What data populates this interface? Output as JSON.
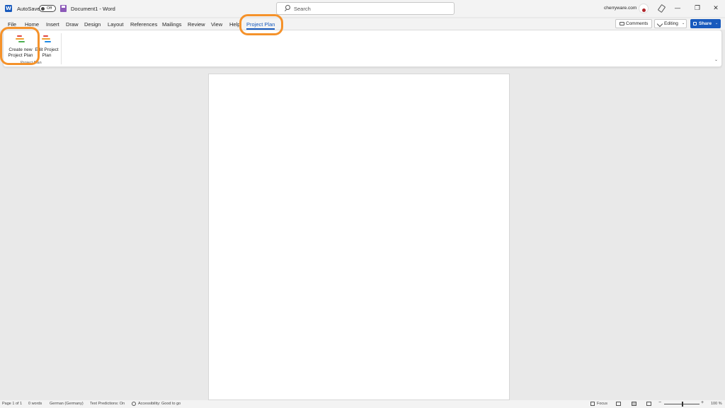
{
  "titlebar": {
    "app_icon": "word-icon",
    "autosave_label": "AutoSave",
    "autosave_state": "Off",
    "doc_title": "Document1  -  Word",
    "account": "cherryware.com",
    "minimize": "—",
    "restore": "❐",
    "close": "✕"
  },
  "search": {
    "placeholder": "Search"
  },
  "tabs": {
    "items": [
      "File",
      "Home",
      "Insert",
      "Draw",
      "Design",
      "Layout",
      "References",
      "Mailings",
      "Review",
      "View",
      "Help",
      "Project Plan"
    ],
    "active": "Project Plan"
  },
  "actions": {
    "comments": "Comments",
    "editing": "Editing",
    "share": "Share",
    "chevron": "⌄"
  },
  "ribbon": {
    "create_label_1": "Create new",
    "create_label_2": "Project Plan",
    "edit_label_1": "Edit Project",
    "edit_label_2": "Plan",
    "group_label": "Project Plan",
    "collapse": "⌄"
  },
  "colors": {
    "accent": "#185abd",
    "highlight": "#f5922a",
    "plan_red": "#e0443c",
    "plan_orange": "#f0a030",
    "plan_green": "#4caf50",
    "plan_blue": "#1e88e5"
  },
  "status": {
    "page": "Page 1 of 1",
    "words": "0 words",
    "language": "German (Germany)",
    "predictions": "Text Predictions: On",
    "accessibility": "Accessibility: Good to go",
    "focus": "Focus",
    "zoom": "100 %",
    "zoom_minus": "−",
    "zoom_plus": "+"
  }
}
